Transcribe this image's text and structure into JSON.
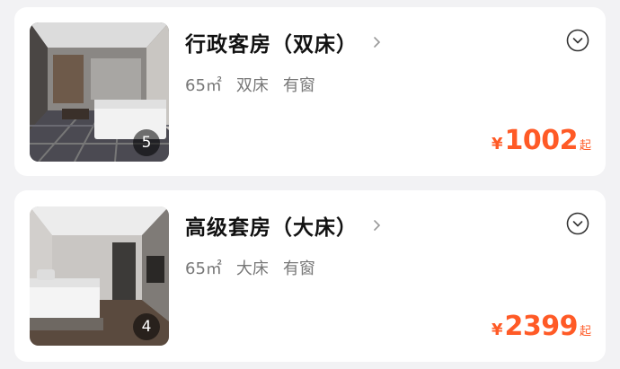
{
  "rooms": [
    {
      "name": "行政客房（双床）",
      "photo_count": "5",
      "specs": [
        "65㎡",
        "双床",
        "有窗"
      ],
      "currency": "¥",
      "price": "1002",
      "price_suffix": "起"
    },
    {
      "name": "高级套房（大床）",
      "photo_count": "4",
      "specs": [
        "65㎡",
        "大床",
        "有窗"
      ],
      "currency": "¥",
      "price": "2399",
      "price_suffix": "起"
    }
  ],
  "colors": {
    "price": "#ff5a26",
    "title": "#111111",
    "spec_text": "#777777",
    "background": "#f2f2f4",
    "card": "#ffffff"
  },
  "icons": {
    "title_arrow": "chevron-right-icon",
    "expand_toggle": "chevron-down-circle-icon",
    "thumbnail": "room-photo"
  }
}
